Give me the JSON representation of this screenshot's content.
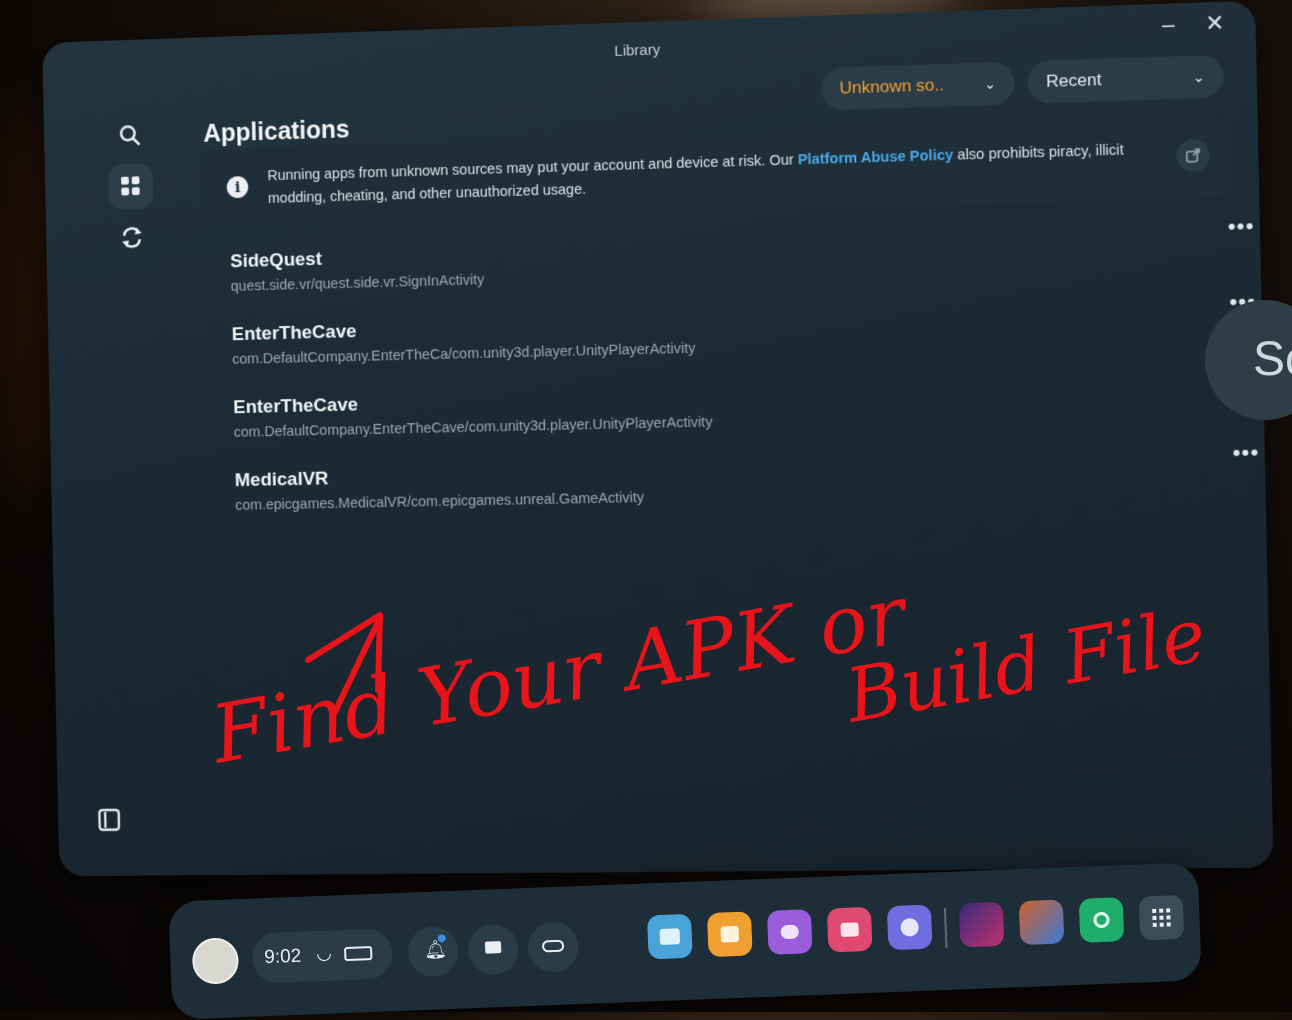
{
  "window": {
    "title": "Library",
    "minimize": "–",
    "close": "✕"
  },
  "sidebar": {
    "items": [
      {
        "name": "search",
        "icon": "search-icon"
      },
      {
        "name": "library",
        "icon": "grid-icon",
        "active": true
      },
      {
        "name": "sync",
        "icon": "sync-icon"
      }
    ],
    "bottom_icon": "panel-icon"
  },
  "page": {
    "title": "Applications",
    "filter_source": "Unknown so..",
    "sort": "Recent"
  },
  "notice": {
    "text": "Running apps from unknown sources may put your account and device at risk. Our ",
    "link": "Platform Abuse Policy",
    "text_after": " also prohibits piracy, illicit modding, cheating, and other unauthorized usage."
  },
  "apps": [
    {
      "name": "SideQuest",
      "package": "quest.side.vr/quest.side.vr.SignInActivity"
    },
    {
      "name": "EnterTheCave",
      "package": "com.DefaultCompany.EnterTheCa/com.unity3d.player.UnityPlayerActivity"
    },
    {
      "name": "EnterTheCave",
      "package": "com.DefaultCompany.EnterTheCave/com.unity3d.player.UnityPlayerActivity"
    },
    {
      "name": "MedicalVR",
      "package": "com.epicgames.MedicalVR/com.epicgames.unreal.GameActivity"
    }
  ],
  "more_label": "•••",
  "side_tab_text": "Sc",
  "annotation": {
    "line1": "Find Your APK or",
    "line2": "Build File"
  },
  "taskbar": {
    "time": "9:02",
    "apps": [
      "files",
      "store",
      "people",
      "camera",
      "browser",
      "game-1",
      "game-2",
      "settings",
      "app-library"
    ]
  },
  "colors": {
    "accent_orange": "#f0a030",
    "link_blue": "#4aa9e9",
    "annotation_red": "#e8141a"
  }
}
